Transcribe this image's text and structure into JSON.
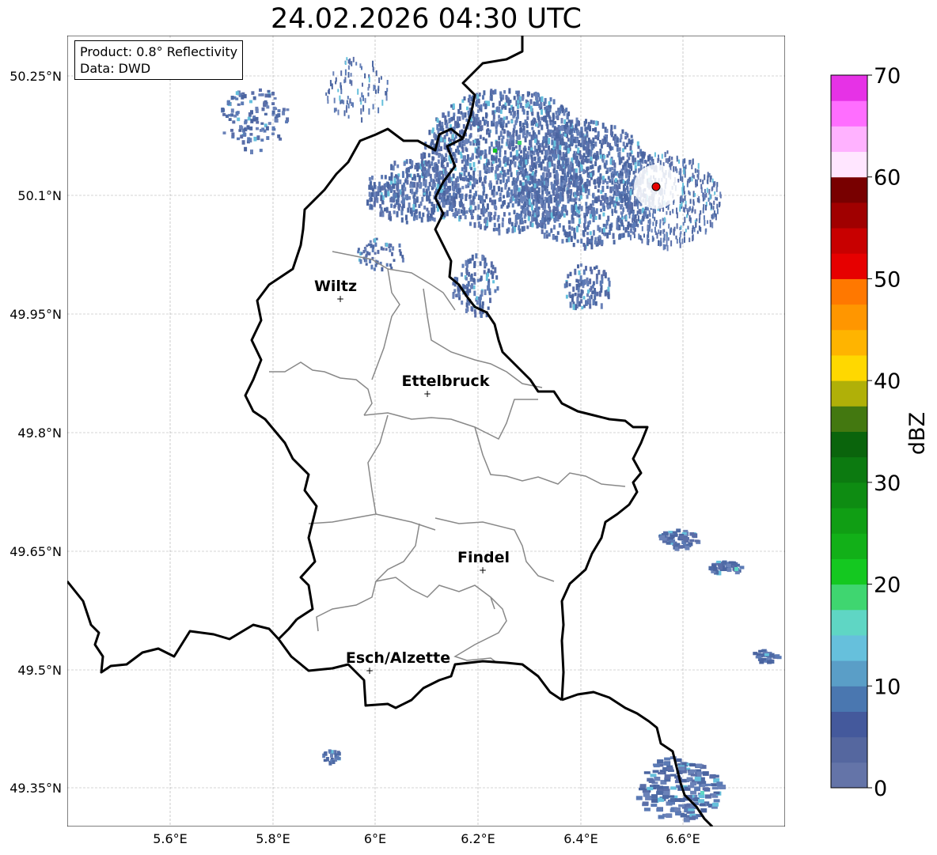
{
  "title": "24.02.2026 04:30 UTC",
  "info": {
    "product": "Product: 0.8° Reflectivity",
    "data": "Data: DWD"
  },
  "lat_labels": [
    "50.25°N",
    "50.1°N",
    "49.95°N",
    "49.8°N",
    "49.65°N",
    "49.5°N",
    "49.35°N"
  ],
  "lon_labels": [
    "5.6°E",
    "5.8°E",
    "6°E",
    "6.2°E",
    "6.4°E",
    "6.6°E"
  ],
  "cities": [
    {
      "name": "Wiltz"
    },
    {
      "name": "Ettelbruck"
    },
    {
      "name": "Findel"
    },
    {
      "name": "Esch/Alzette"
    }
  ],
  "colorbar": {
    "label": "dBZ",
    "ticks": [
      "0",
      "10",
      "20",
      "30",
      "40",
      "50",
      "60",
      "70"
    ],
    "colors": [
      "#6474a8",
      "#55679f",
      "#44599c",
      "#4a77b0",
      "#5a9ec7",
      "#66c0dc",
      "#5fd6c4",
      "#3fd670",
      "#14c820",
      "#12b018",
      "#109e14",
      "#0e8c12",
      "#0c7a10",
      "#0a640c",
      "#437810",
      "#b0b008",
      "#ffd800",
      "#ffb400",
      "#ff9600",
      "#ff7800",
      "#e60000",
      "#c80000",
      "#a00000",
      "#780000",
      "#ffe6ff",
      "#ffb2ff",
      "#ff6eff",
      "#e632e6"
    ]
  },
  "radar_site_color": "#e60000"
}
